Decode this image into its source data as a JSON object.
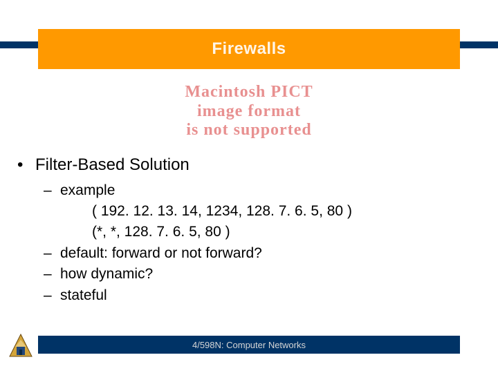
{
  "title": "Firewalls",
  "placeholder": {
    "line1": "Macintosh PICT",
    "line2": "image format",
    "line3": "is not supported"
  },
  "main_bullet": "Filter-Based Solution",
  "sub": {
    "example": "example",
    "tuple1": "( 192. 12. 13. 14, 1234, 128. 7. 6. 5, 80 )",
    "tuple2": "(*, *, 128. 7. 6. 5, 80 )",
    "default": "default: forward or not forward?",
    "dynamic": "how dynamic?",
    "stateful": "stateful"
  },
  "footer": "4/598N: Computer Networks",
  "colors": {
    "title_bg": "#ff9900",
    "bar_bg": "#003366",
    "placeholder_text": "#e89090"
  }
}
